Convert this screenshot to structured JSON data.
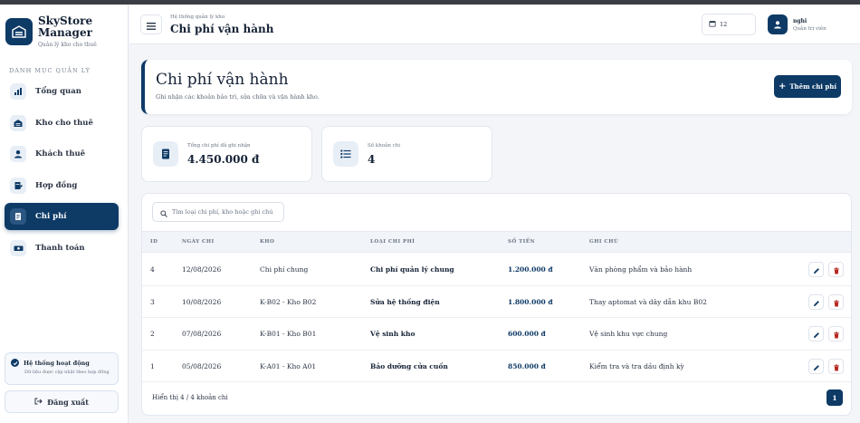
{
  "brand": {
    "name_line1": "SkyStore",
    "name_line2": "Manager",
    "subtitle": "Quản lý kho cho thuê"
  },
  "sidebar": {
    "section_label": "DANH MỤC QUẢN LÝ",
    "items": [
      {
        "label": "Tổng quan",
        "icon": "chart-icon",
        "active": false
      },
      {
        "label": "Kho cho thuê",
        "icon": "warehouse-icon",
        "active": false
      },
      {
        "label": "Khách thuê",
        "icon": "user-icon",
        "active": false
      },
      {
        "label": "Hợp đồng",
        "icon": "contract-icon",
        "active": false
      },
      {
        "label": "Chi phí",
        "icon": "receipt-icon",
        "active": true
      },
      {
        "label": "Thanh toán",
        "icon": "money-icon",
        "active": false
      }
    ],
    "status": {
      "title": "Hệ thống hoạt động",
      "desc": "Dữ liệu được cập nhật theo hợp đồng"
    },
    "logout_label": "Đăng xuất"
  },
  "header": {
    "crumb": "Hệ thống quản lý kho",
    "title": "Chi phí vận hành",
    "date": "12",
    "user_name": "nghi",
    "user_role": "Quản trị viên"
  },
  "hero": {
    "title": "Chi phí vận hành",
    "subtitle": "Ghi nhận các khoản bảo trì, sửa chữa và vận hành kho.",
    "add_label": "Thêm chi phí"
  },
  "stats": [
    {
      "label": "Tổng chi phí đã ghi nhận",
      "value": "4.450.000 đ",
      "icon": "document-icon"
    },
    {
      "label": "Số khoản chi",
      "value": "4",
      "icon": "list-icon"
    }
  ],
  "table": {
    "search_placeholder": "Tìm loại chi phí, kho hoặc ghi chú",
    "columns": [
      "ID",
      "NGÀY CHI",
      "KHO",
      "LOẠI CHI PHÍ",
      "SỐ TIỀN",
      "GHI CHÚ"
    ],
    "rows": [
      {
        "id": "4",
        "date": "12/08/2026",
        "warehouse": "Chi phí chung",
        "type": "Chi phí quản lý chung",
        "amount": "1.200.000 đ",
        "note": "Văn phòng phẩm và bảo hành"
      },
      {
        "id": "3",
        "date": "10/08/2026",
        "warehouse": "K-B02 - Kho B02",
        "type": "Sửa hệ thống điện",
        "amount": "1.800.000 đ",
        "note": "Thay aptomat và dây dẫn khu B02"
      },
      {
        "id": "2",
        "date": "07/08/2026",
        "warehouse": "K-B01 - Kho B01",
        "type": "Vệ sinh kho",
        "amount": "600.000 đ",
        "note": "Vệ sinh khu vực chung"
      },
      {
        "id": "1",
        "date": "05/08/2026",
        "warehouse": "K-A01 - Kho A01",
        "type": "Bảo dưỡng cửa cuốn",
        "amount": "850.000 đ",
        "note": "Kiểm tra và tra dầu định kỳ"
      }
    ],
    "footer": "Hiển thị 4 / 4 khoản chi",
    "page": "1"
  },
  "colors": {
    "primary": "#0e3a66",
    "danger": "#b3261e",
    "edit": "#0e3a66"
  }
}
